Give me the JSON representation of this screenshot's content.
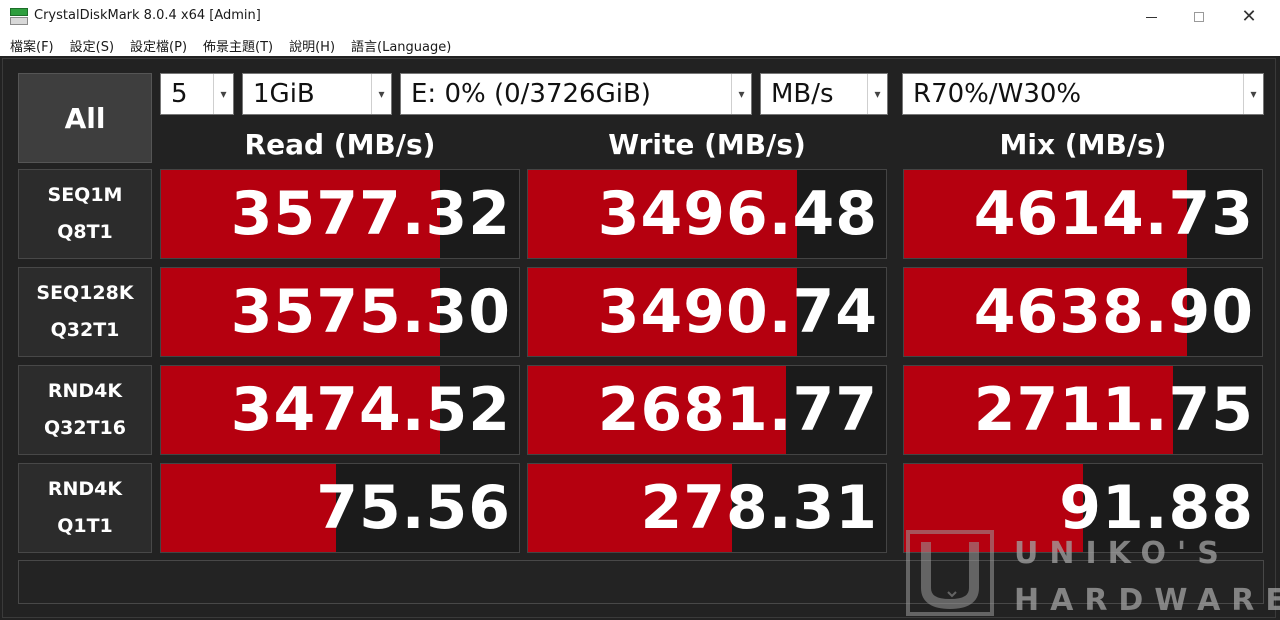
{
  "window": {
    "title": "CrystalDiskMark 8.0.4 x64 [Admin]",
    "minimize_icon": "minimize-icon",
    "maximize_icon": "maximize-icon",
    "close_glyph": "✕"
  },
  "menu": [
    "檔案(F)",
    "設定(S)",
    "設定檔(P)",
    "佈景主題(T)",
    "說明(H)",
    "語言(Language)"
  ],
  "controls": {
    "all_label": "All",
    "count": "5",
    "size": "1GiB",
    "drive": "E: 0% (0/3726GiB)",
    "unit": "MB/s",
    "mix_ratio": "R70%/W30%",
    "caret": "▾"
  },
  "columns": {
    "read": "Read (MB/s)",
    "write": "Write (MB/s)",
    "mix": "Mix (MB/s)"
  },
  "rows": [
    {
      "line1": "SEQ1M",
      "line2": "Q8T1",
      "read": "3577.32",
      "write": "3496.48",
      "mix": "4614.73",
      "read_fill": 0.78,
      "write_fill": 0.75,
      "mix_fill": 0.79
    },
    {
      "line1": "SEQ128K",
      "line2": "Q32T1",
      "read": "3575.30",
      "write": "3490.74",
      "mix": "4638.90",
      "read_fill": 0.78,
      "write_fill": 0.75,
      "mix_fill": 0.79
    },
    {
      "line1": "RND4K",
      "line2": "Q32T16",
      "read": "3474.52",
      "write": "2681.77",
      "mix": "2711.75",
      "read_fill": 0.78,
      "write_fill": 0.72,
      "mix_fill": 0.75
    },
    {
      "line1": "RND4K",
      "line2": "Q1T1",
      "read": "75.56",
      "write": "278.31",
      "mix": "91.88",
      "read_fill": 0.49,
      "write_fill": 0.57,
      "mix_fill": 0.5
    }
  ],
  "status_text": "",
  "watermark": {
    "line1": "UNIKO'S",
    "line2": "HARDWARE"
  },
  "colors": {
    "bar_fill": "#b5000f",
    "background": "#222222"
  }
}
